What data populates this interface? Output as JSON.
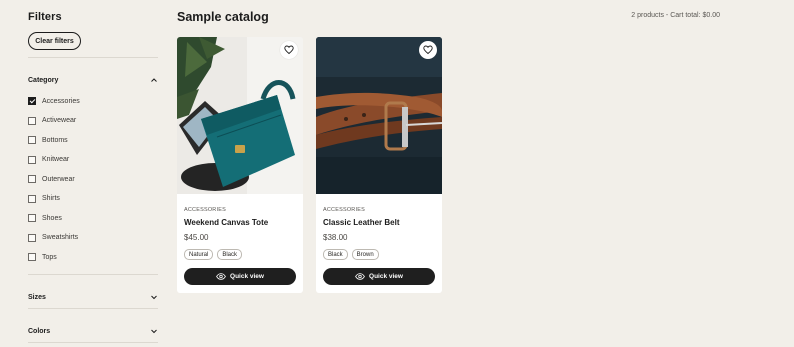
{
  "sidebar": {
    "title": "Filters",
    "clear_label": "Clear filters",
    "category": {
      "label": "Category",
      "items": [
        {
          "label": "Accessories",
          "checked": true
        },
        {
          "label": "Activewear",
          "checked": false
        },
        {
          "label": "Bottoms",
          "checked": false
        },
        {
          "label": "Knitwear",
          "checked": false
        },
        {
          "label": "Outerwear",
          "checked": false
        },
        {
          "label": "Shirts",
          "checked": false
        },
        {
          "label": "Shoes",
          "checked": false
        },
        {
          "label": "Sweatshirts",
          "checked": false
        },
        {
          "label": "Tops",
          "checked": false
        }
      ]
    },
    "sizes_label": "Sizes",
    "colors_label": "Colors"
  },
  "main": {
    "title": "Sample catalog",
    "summary": "2 products - Cart total: $0.00"
  },
  "products": [
    {
      "category": "ACCESSORIES",
      "name": "Weekend Canvas Tote",
      "price": "$45.00",
      "tags": [
        "Natural",
        "Black"
      ],
      "quick_view": "Quick view"
    },
    {
      "category": "ACCESSORIES",
      "name": "Classic Leather Belt",
      "price": "$38.00",
      "tags": [
        "Black",
        "Brown"
      ],
      "quick_view": "Quick view"
    }
  ],
  "colors": {
    "background": "#f2efe9",
    "button_dark": "#1f1f1f",
    "card": "#ffffff"
  }
}
